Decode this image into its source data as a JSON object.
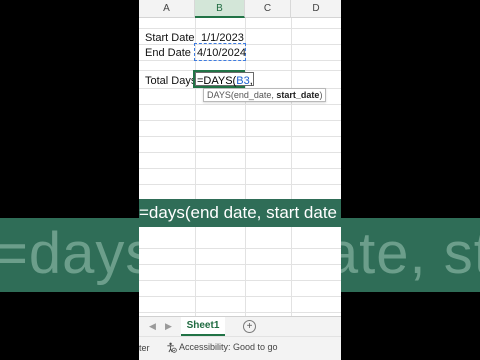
{
  "background": {
    "band_text": "=days(end date,  start date"
  },
  "columns": [
    "A",
    "B",
    "C",
    "D"
  ],
  "cells": {
    "a2": "Start Date",
    "b2": "1/1/2023",
    "a3": "End Date",
    "b3": "4/10/2024",
    "a5": "Total Days",
    "b5_formula_prefix": "=DAYS(",
    "b5_formula_ref": "B3",
    "b5_formula_suffix": ","
  },
  "tooltip": {
    "func": "DAYS(",
    "arg1": "end_date",
    "sep": ", ",
    "arg2": "start_date",
    "close": ")"
  },
  "caption": "=days(end date,  start date",
  "sheet_tab": "Sheet1",
  "add_sheet_symbol": "+",
  "status": {
    "left_fragment": "ter",
    "accessibility": "Accessibility: Good to go"
  },
  "colors": {
    "excel_green": "#217346",
    "caption_bg": "#2f6d57",
    "ref_blue": "#1c5fcf"
  }
}
